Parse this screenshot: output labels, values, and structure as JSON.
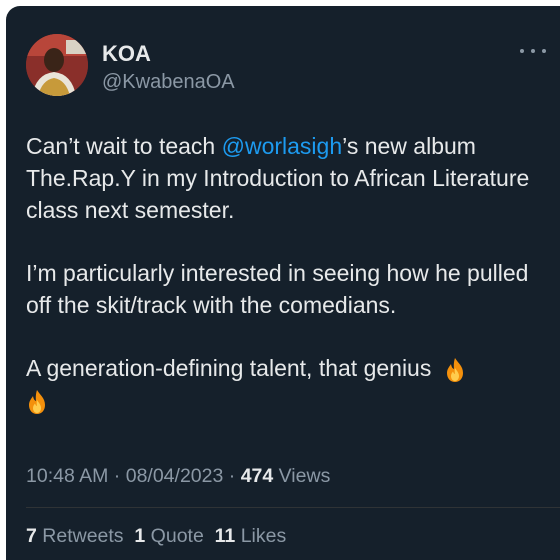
{
  "author": {
    "name": "KOA",
    "handle": "@KwabenaOA"
  },
  "tweet": {
    "line1_pre": "Can’t wait to teach ",
    "mention": "@worlasigh",
    "line1_post": "’s new album The.Rap.Y in my Introduction to African Literature class next semester.",
    "para2": "I’m particularly interested in seeing how he pulled off the skit/track with the comedians.",
    "para3": "A generation-defining talent, that genius",
    "emoji": [
      "fire-emoji",
      "fire-emoji"
    ]
  },
  "meta": {
    "time": "10:48 AM",
    "sep1": " · ",
    "date": "08/04/2023",
    "sep2": " · ",
    "views_count": "474",
    "views_label": " Views"
  },
  "stats": {
    "retweets_count": "7",
    "retweets_label": " Retweets",
    "quotes_count": "1",
    "quotes_label": " Quote",
    "likes_count": "11",
    "likes_label": " Likes"
  },
  "colors": {
    "background": "#15202b",
    "text": "#e7e9ea",
    "secondary": "#8b98a5",
    "link": "#1d9bf0",
    "divider": "#2f3336"
  }
}
